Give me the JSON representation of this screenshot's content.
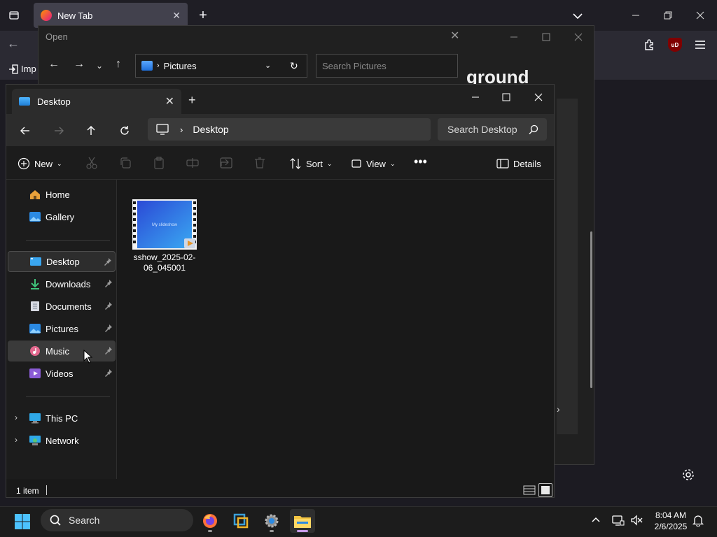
{
  "firefox": {
    "tab_title": "New Tab",
    "new_tab_glyph": "+",
    "import_label": "Imp",
    "ublock_label": "uD",
    "back_glyph": "←"
  },
  "open_dialog": {
    "title": "Open",
    "address_path": "Pictures",
    "search_placeholder": "Search Pictures",
    "heading_fragment": "ground"
  },
  "explorer": {
    "tab_label": "Desktop",
    "address_path": "Desktop",
    "search_placeholder": "Search Desktop",
    "commands": {
      "new_label": "New",
      "sort_label": "Sort",
      "view_label": "View",
      "details_label": "Details"
    },
    "nav_items": [
      {
        "label": "Home",
        "icon": "home-icon"
      },
      {
        "label": "Gallery",
        "icon": "gallery-icon"
      },
      {
        "label": "Desktop",
        "icon": "desktop-icon",
        "pinned": true,
        "selected": true
      },
      {
        "label": "Downloads",
        "icon": "download-icon",
        "pinned": true
      },
      {
        "label": "Documents",
        "icon": "document-icon",
        "pinned": true
      },
      {
        "label": "Pictures",
        "icon": "pictures-icon",
        "pinned": true
      },
      {
        "label": "Music",
        "icon": "music-icon",
        "pinned": true,
        "hover": true
      },
      {
        "label": "Videos",
        "icon": "videos-icon",
        "pinned": true
      },
      {
        "label": "This PC",
        "icon": "this-pc-icon",
        "expandable": true
      },
      {
        "label": "Network",
        "icon": "network-icon",
        "expandable": true
      }
    ],
    "files": [
      {
        "name": "sshow_2025-02-06_045001",
        "thumb_text": "My slideshow",
        "type": "video"
      }
    ],
    "status_count": "1 item"
  },
  "taskbar": {
    "search_label": "Search",
    "time": "8:04 AM",
    "date": "2/6/2025",
    "apps": [
      "firefox-icon",
      "virtualbox-icon",
      "settings-gear-icon",
      "file-explorer-icon"
    ]
  },
  "colors": {
    "accent": "#4fb6ff",
    "active_indicator": "#c79be8",
    "window_bg": "#191919"
  }
}
